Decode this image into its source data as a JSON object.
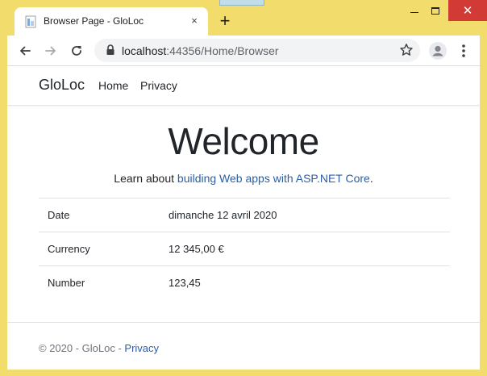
{
  "browser": {
    "tab_title": "Browser Page - GloLoc",
    "tab_close": "×",
    "new_tab": "+",
    "window_close": "✕",
    "url_host": "localhost",
    "url_rest": ":44356/Home/Browser",
    "icons": {
      "favicon": "page-favicon-icon",
      "back": "back-arrow-icon",
      "forward": "forward-arrow-icon",
      "reload": "reload-icon",
      "lock": "lock-icon",
      "star": "star-icon",
      "profile": "profile-avatar-icon",
      "menu": "kebab-menu-icon"
    },
    "colors": {
      "frame": "#f1dc6c",
      "close": "#d23a36"
    }
  },
  "site": {
    "brand": "GloLoc",
    "nav": [
      "Home",
      "Privacy"
    ],
    "heading": "Welcome",
    "learn_prefix": "Learn about ",
    "learn_link": "building Web apps with ASP.NET Core",
    "learn_suffix": ".",
    "table": [
      {
        "label": "Date",
        "value": "dimanche 12 avril 2020"
      },
      {
        "label": "Currency",
        "value": "12 345,00 €"
      },
      {
        "label": "Number",
        "value": "123,45"
      }
    ],
    "footer_prefix": "© 2020 - GloLoc - ",
    "footer_link": "Privacy",
    "link_color": "#2a5ea6"
  }
}
